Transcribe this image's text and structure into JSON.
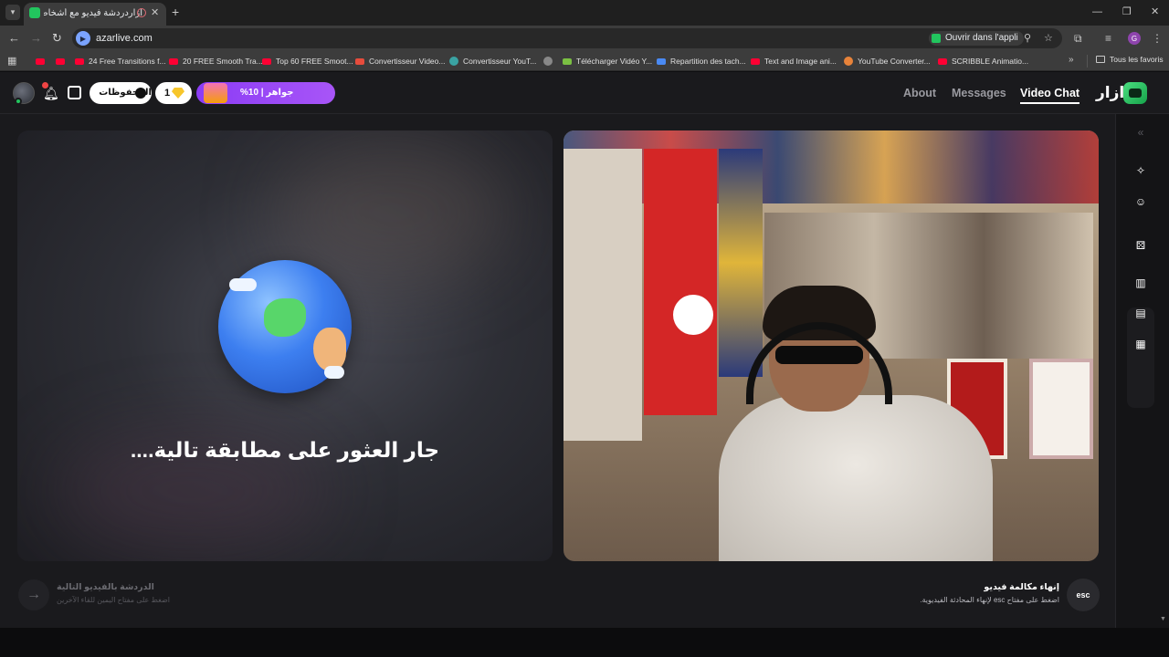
{
  "browser": {
    "tab_title": "أزاردردشة فيديو مع أشخاص",
    "url": "azarlive.com",
    "open_in_app": "Ouvrir dans l'appli",
    "profile_initial": "G",
    "bookmarks": [
      "24 Free Transitions f...",
      "20 FREE Smooth Tra...",
      "Top 60 FREE Smoot...",
      "Convertisseur Video...",
      "Convertisseur YouT...",
      "Télécharger Vidéo Y...",
      "Repartition des tach...",
      "Text and Image ani...",
      "YouTube Converter...",
      "SCRIBBLE Animatio..."
    ],
    "all_bookmarks": "Tous les favoris"
  },
  "header": {
    "brand": "ازار",
    "nav": [
      "About",
      "Messages",
      "Video Chat"
    ],
    "active_nav": "Video Chat",
    "saved_label": "المحفوظات",
    "gem_count": "1",
    "promo_label": "جواهر | 10%"
  },
  "main": {
    "searching_text": "جار العثور على مطابقة تالية....",
    "next_title": "الدردشة بالفيديو التالية",
    "next_hint": "اضغط على مفتاح اليمين للقاء الآخرين",
    "end_title": "إنهاء مكالمة فيديو",
    "end_hint": "اضغط على مفتاح esc لإنهاء المحادثة الفيديوية.",
    "esc_label": "esc"
  },
  "colors": {
    "accent_green": "#22c55e",
    "promo_purple": "#8b3cf6",
    "background": "#1a1a1d"
  }
}
